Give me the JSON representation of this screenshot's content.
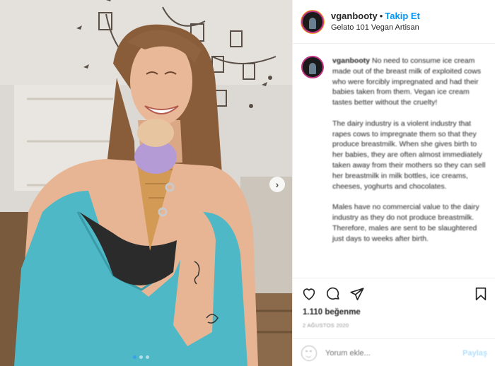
{
  "header": {
    "username": "vganbooty",
    "separator": "•",
    "follow_label": "Takip Et",
    "location": "Gelato 101 Vegan Artisan"
  },
  "caption": {
    "username": "vganbooty",
    "paragraphs": [
      "No need to consume ice cream made out of the breast milk of exploited cows who were forcibly impregnated and had their babies taken from them. Vegan ice cream tastes better without the cruelty!",
      "The dairy industry is a violent industry that rapes cows to impregnate them so that they produce breastmilk. When she gives birth to her babies, they are often almost immediately taken away from their mothers so they can sell her breastmilk in milk bottles, ice creams, cheeses, yoghurts and chocolates.",
      "Males have no commercial value to the dairy industry as they do not produce breastmilk. Therefore, males are sent to be slaughtered just days to weeks after birth."
    ]
  },
  "stats": {
    "likes": "1.110 beğenme",
    "date": "2 AĞUSTOS 2020"
  },
  "comment": {
    "placeholder": "Yorum ekle...",
    "post_label": "Paylaş"
  },
  "carousel": {
    "next_glyph": "›",
    "slides": 3,
    "active_index": 0
  },
  "icons": {
    "like": "heart-icon",
    "comment": "comment-icon",
    "share": "share-icon",
    "save": "bookmark-icon",
    "next": "chevron-right-icon",
    "emoji": "emoji-icon"
  },
  "colors": {
    "follow": "#0095f6",
    "post_disabled": "#b2dffc",
    "active_dot": "#3aa0e6"
  }
}
